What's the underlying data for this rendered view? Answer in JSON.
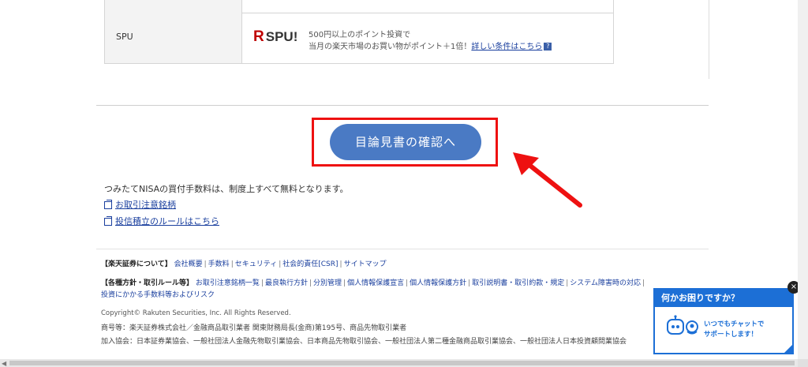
{
  "table": {
    "spu_label": "SPU",
    "spu_logo_r": "R",
    "spu_logo_text": "SPU!",
    "spu_line1": "500円以上のポイント投資で",
    "spu_line2_prefix": "当月の楽天市場のお買い物がポイント＋1倍！",
    "spu_detail_link": "詳しい条件はこちら",
    "help_icon_glyph": "?"
  },
  "main": {
    "mokuromi_button": "目論見書の確認へ",
    "nisa_note": "つみたてNISAの買付手数料は、制度上すべて無料となります。",
    "link_caution": "お取引注意銘柄",
    "link_rules": "投信積立のルールはこちら"
  },
  "footer": {
    "about_heading": "【楽天証券について】",
    "about_links": [
      "会社概要",
      "手数料",
      "セキュリティ",
      "社会的責任[CSR]",
      "サイトマップ"
    ],
    "policy_heading": "【各種方針・取引ルール等】",
    "policy_links": [
      "お取引注意銘柄一覧",
      "最良執行方針",
      "分別管理",
      "個人情報保護宣言",
      "個人情報保護方針",
      "取引説明書・取引約款・規定",
      "システム障害時の対応"
    ],
    "policy_link_2": "投資にかかる手数料等およびリスク",
    "copyright": "Copyright© Rakuten Securities, Inc. All Rights Reserved.",
    "registration": "商号等：楽天証券株式会社／金融商品取引業者 関東財務局長(金商)第195号、商品先物取引業者",
    "associations": "加入協会：日本証券業協会、一般社団法人金融先物取引業協会、日本商品先物取引協会、一般社団法人第二種金融商品取引業協会、一般社団法人日本投資顧問業協会"
  },
  "chat": {
    "title": "何かお困りですか？",
    "body_line1": "いつでもチャットで",
    "body_line2": "サポートします！",
    "close_glyph": "×"
  },
  "colors": {
    "accent_blue": "#4a7ac4",
    "highlight_red": "#e11111",
    "chat_blue": "#1c6fd6",
    "link_blue": "#1a3f9e"
  }
}
